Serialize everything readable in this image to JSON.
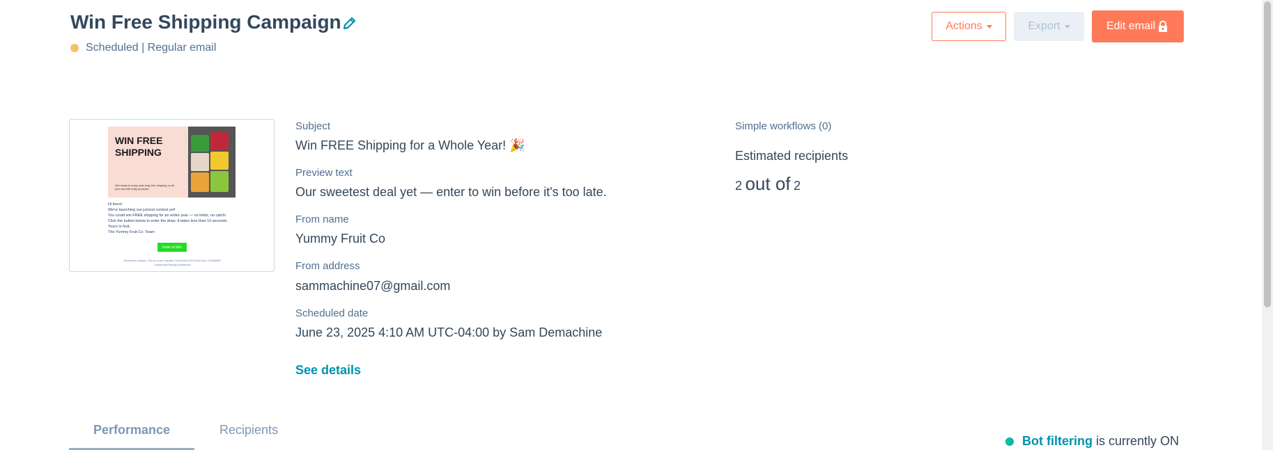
{
  "header": {
    "title": "Win Free Shipping Campaign",
    "status": "Scheduled | Regular email",
    "status_color": "#f5c26b",
    "actions_label": "Actions",
    "export_label": "Export",
    "edit_label": "Edit email"
  },
  "preview": {
    "hero_title": "WIN FREE\nSHIPPING",
    "hero_sub": "Get ready to enjoy year-long free shipping on all your favorite fruity products.",
    "greeting": "Hi there!",
    "lines": [
      "We're launching our juiciest contest yet!",
      "You could win FREE shipping for an entire year — no limits, no catch!",
      "Click the button below to enter the draw. It takes less than 10 seconds.",
      "Yours in fruit,",
      "The Yummy Fruit Co. Team"
    ],
    "cta": "Enter to Win",
    "footer": "Demachine solutions, 748 rue nome, mamdea, North Krisa 3749 North Krisa, 9732466987",
    "footer_link": "Unsubscribe Manage preferences"
  },
  "details": {
    "subject_label": "Subject",
    "subject_value": "Win FREE Shipping for a Whole Year! 🎉",
    "preview_label": "Preview text",
    "preview_value": "Our sweetest deal yet — enter to win before it's too late.",
    "from_name_label": "From name",
    "from_name_value": "Yummy Fruit Co",
    "from_address_label": "From address",
    "from_address_value": "sammachine07@gmail.com",
    "scheduled_label": "Scheduled date",
    "scheduled_value": "June 23, 2025 4:10 AM UTC-04:00 by Sam Demachine",
    "see_details": "See details"
  },
  "recipients": {
    "workflows_label": "Simple workflows (0)",
    "estimated_label": "Estimated recipients",
    "count": "2",
    "out_of": "out of",
    "total": "2"
  },
  "tabs": {
    "performance": "Performance",
    "recipients": "Recipients"
  },
  "bot_filter": {
    "link": "Bot filtering",
    "text": "is currently ON",
    "indicator_color": "#00bda5"
  }
}
